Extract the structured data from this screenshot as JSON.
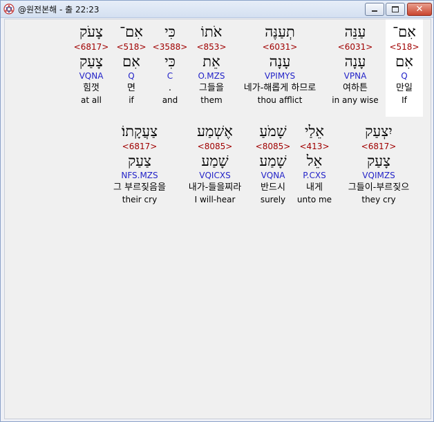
{
  "window": {
    "title": "@원전본해 - 출 22:23"
  },
  "rows": [
    {
      "words": [
        {
          "hebrew": "אִם־",
          "strong": "<518>",
          "lemma": "אִם",
          "morph": "Q",
          "korean": "만일",
          "english": "If",
          "selected": true
        },
        {
          "hebrew": "עַנֵּה",
          "strong": "<6031>",
          "lemma": "עָנָה",
          "morph": "VPNA",
          "korean": "여하튼",
          "english": "in any wise"
        },
        {
          "hebrew": "תְעַנֶּה",
          "strong": "<6031>",
          "lemma": "עָנָה",
          "morph": "VPIMYS",
          "korean": "네가-해롭게 하므로",
          "english": "thou afflict"
        },
        {
          "hebrew": "אֹתוֹ",
          "strong": "<853>",
          "lemma": "אֵת",
          "morph": "O.MZS",
          "korean": "그들을",
          "english": "them"
        },
        {
          "hebrew": "כִּי",
          "strong": "<3588>",
          "lemma": "כִּי",
          "morph": "C",
          "korean": ".",
          "english": "and"
        },
        {
          "hebrew": "אִם־",
          "strong": "<518>",
          "lemma": "אִם",
          "morph": "Q",
          "korean": "면",
          "english": "if"
        },
        {
          "hebrew": "צָעֹק",
          "strong": "<6817>",
          "lemma": "צָעַק",
          "morph": "VQNA",
          "korean": "힘껏",
          "english": "at all"
        }
      ]
    },
    {
      "words": [
        {
          "hebrew": "יִצְעַק",
          "strong": "<6817>",
          "lemma": "צָעַק",
          "morph": "VQIMZS",
          "korean": "그들이-부르짖으",
          "english": "they cry"
        },
        {
          "hebrew": "אֵלַי",
          "strong": "<413>",
          "lemma": "אֵל",
          "morph": "P.CXS",
          "korean": "내게",
          "english": "unto me"
        },
        {
          "hebrew": "שָׁמֹעַ",
          "strong": "<8085>",
          "lemma": "שָׁמַע",
          "morph": "VQNA",
          "korean": "반드시",
          "english": "surely"
        },
        {
          "hebrew": "אֶשְׁמַע",
          "strong": "<8085>",
          "lemma": "שָׁמַע",
          "morph": "VQICXS",
          "korean": "내가-들을찌라",
          "english": "I will-hear"
        },
        {
          "hebrew": "צַעֲקָתוֹ׃",
          "strong": "<6817>",
          "lemma": "צַעַק",
          "morph": "NFS.MZS",
          "korean": "그 부르짖음을",
          "english": "their cry"
        }
      ]
    }
  ]
}
